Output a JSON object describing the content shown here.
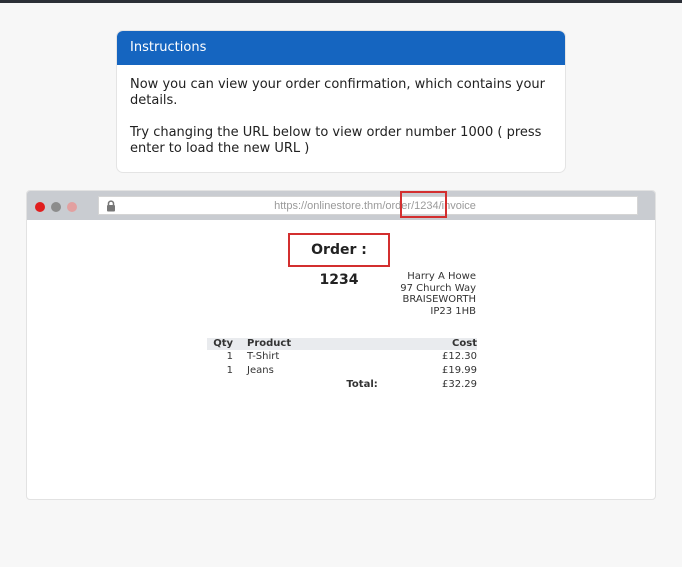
{
  "instructions": {
    "title": "Instructions",
    "paragraph1": "Now you can view your order confirmation, which contains your details.",
    "paragraph2": "Try changing the URL below to view order number 1000 ( press enter to load the new URL )"
  },
  "browser": {
    "url": "https://onlinestore.thm/order/1234/invoice",
    "lock_icon": "lock-icon",
    "colors": {
      "chrome": "#c9ccd1",
      "close_dot": "#e01e1e",
      "highlight": "#d32f2f"
    }
  },
  "invoice": {
    "order_title": "Order : 1234",
    "address": [
      "Harry A Howe",
      "97 Church Way",
      "BRAISEWORTH",
      "IP23 1HB"
    ],
    "table": {
      "headers": {
        "qty": "Qty",
        "product": "Product",
        "cost": "Cost"
      },
      "rows": [
        {
          "qty": "1",
          "product": "T-Shirt",
          "cost": "£12.30"
        },
        {
          "qty": "1",
          "product": "Jeans",
          "cost": "£19.99"
        }
      ],
      "total_label": "Total:",
      "total_value": "£32.29"
    }
  },
  "accent_color": "#1565c0"
}
